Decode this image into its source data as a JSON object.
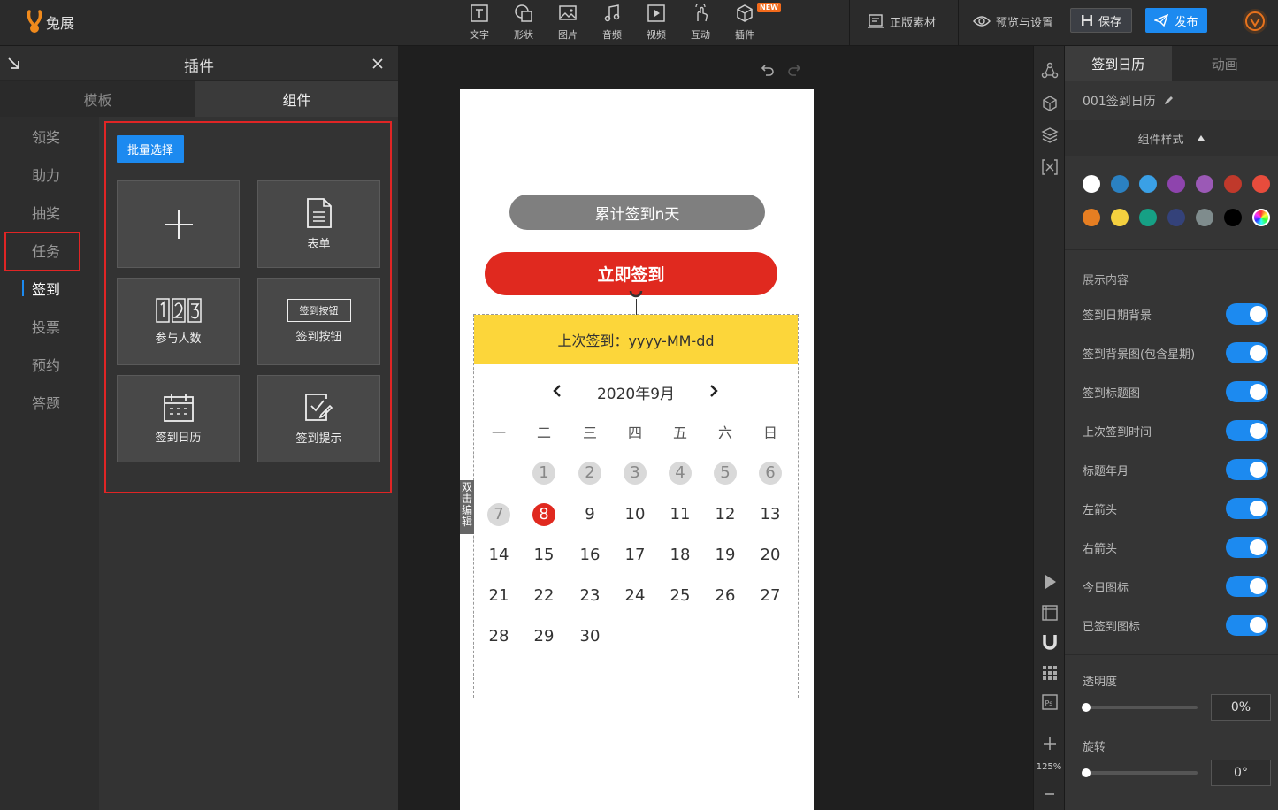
{
  "app": {
    "logo_text": "兔展"
  },
  "toolbar": {
    "tools": [
      "文字",
      "形状",
      "图片",
      "音频",
      "视频",
      "互动",
      "插件"
    ],
    "new_badge": "NEW",
    "assets_label": "正版素材",
    "preview_label": "预览与设置",
    "save_label": "保存",
    "publish_label": "发布"
  },
  "plugin_panel": {
    "title": "插件",
    "tabs": [
      "模板",
      "组件"
    ],
    "active_tab": "组件",
    "categories": [
      "领奖",
      "助力",
      "抽奖",
      "任务",
      "签到",
      "投票",
      "预约",
      "答题"
    ],
    "active_category": "签到",
    "batch_select_label": "批量选择",
    "components": [
      "表单",
      "参与人数",
      "签到按钮",
      "签到日历",
      "签到提示"
    ],
    "button_icon_text": "签到按钮"
  },
  "canvas": {
    "counter_text": "累计签到n天",
    "signin_button": "立即签到",
    "last_signin": "上次签到：yyyy-MM-dd",
    "month_label": "2020年9月",
    "weekdays": [
      "一",
      "二",
      "三",
      "四",
      "五",
      "六",
      "日"
    ],
    "days": [
      "1",
      "2",
      "3",
      "4",
      "5",
      "6",
      "7",
      "8",
      "9",
      "10",
      "11",
      "12",
      "13",
      "14",
      "15",
      "16",
      "17",
      "18",
      "19",
      "20",
      "21",
      "22",
      "23",
      "24",
      "25",
      "26",
      "27",
      "28",
      "29",
      "30"
    ],
    "signed_days": [
      1,
      2,
      3,
      4,
      5,
      6,
      7
    ],
    "today": 8,
    "edit_hint": "双击编辑"
  },
  "side_strip": {
    "zoom": "125%"
  },
  "right_panel": {
    "tabs": [
      "签到日历",
      "动画"
    ],
    "active_tab": "签到日历",
    "component_name": "001签到日历",
    "style_header": "组件样式",
    "colors": [
      "#ffffff",
      "#2b81c2",
      "#3aa0e6",
      "#8e44ad",
      "#9b59b6",
      "#c0392b",
      "#e74c3c",
      "#e67e22",
      "#f4d03f",
      "#16a085",
      "#34427a",
      "#7f8c8d",
      "#000000"
    ],
    "show_content_title": "展示内容",
    "toggles": [
      {
        "label": "签到日期背景",
        "on": true
      },
      {
        "label": "签到背景图(包含星期)",
        "on": true
      },
      {
        "label": "签到标题图",
        "on": true
      },
      {
        "label": "上次签到时间",
        "on": true
      },
      {
        "label": "标题年月",
        "on": true
      },
      {
        "label": "左箭头",
        "on": true
      },
      {
        "label": "右箭头",
        "on": true
      },
      {
        "label": "今日图标",
        "on": true
      },
      {
        "label": "已签到图标",
        "on": true
      }
    ],
    "opacity_label": "透明度",
    "opacity_value": "0%",
    "rotation_label": "旋转",
    "rotation_value": "0°"
  }
}
